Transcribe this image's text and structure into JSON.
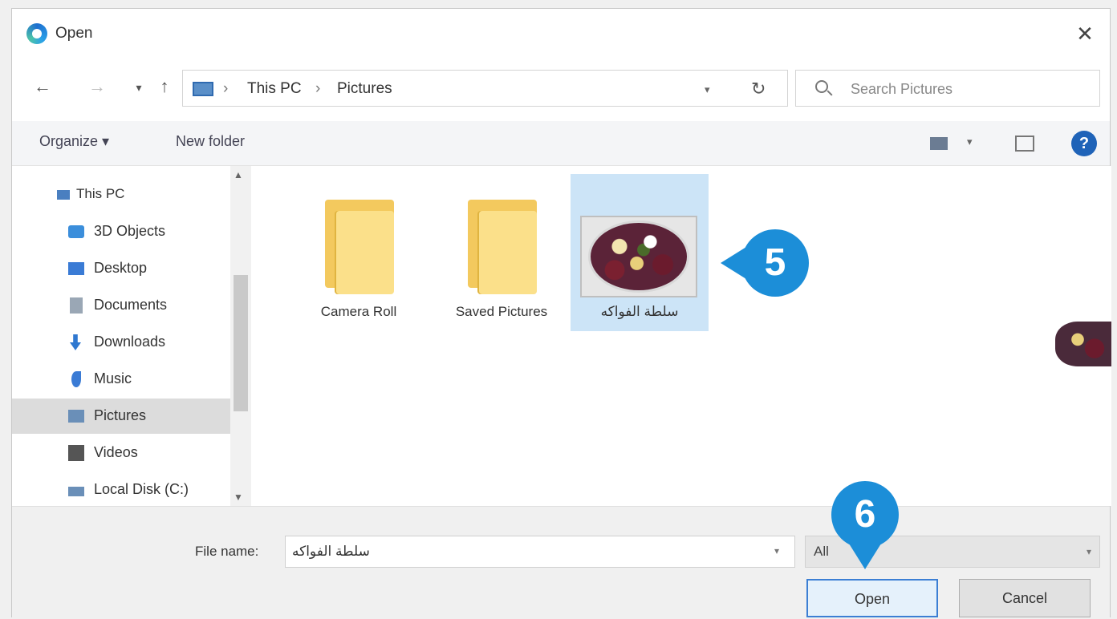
{
  "window": {
    "title": "Open",
    "close_symbol": "✕"
  },
  "nav": {
    "back": "←",
    "forward": "→",
    "recent": "▾",
    "up": "↑"
  },
  "address": {
    "sep": "›",
    "crumbs": [
      "This PC",
      "Pictures"
    ],
    "dropdown": "▾",
    "refresh": "↻"
  },
  "search": {
    "placeholder": "Search Pictures"
  },
  "toolbar": {
    "organize": "Organize ▾",
    "new_folder": "New folder",
    "view_dropdown": "▾",
    "help": "?"
  },
  "sidebar": {
    "scroll_up": "▲",
    "scroll_down": "▼",
    "items": [
      {
        "label": "This PC",
        "icon": "pc-icon",
        "color": "#4a7fc0"
      },
      {
        "label": "3D Objects",
        "icon": "cube-icon",
        "color": "#3b8edb"
      },
      {
        "label": "Desktop",
        "icon": "desktop-icon",
        "color": "#3a7bd5"
      },
      {
        "label": "Documents",
        "icon": "documents-icon",
        "color": "#9aa7b5"
      },
      {
        "label": "Downloads",
        "icon": "download-icon",
        "color": "#2f78d0"
      },
      {
        "label": "Music",
        "icon": "music-icon",
        "color": "#3a7bd5"
      },
      {
        "label": "Pictures",
        "icon": "pictures-icon",
        "color": "#6a8fb8"
      },
      {
        "label": "Videos",
        "icon": "videos-icon",
        "color": "#555"
      },
      {
        "label": "Local Disk (C:)",
        "icon": "disk-icon",
        "color": "#6a8fb8"
      }
    ],
    "selected_index": 6
  },
  "files": [
    {
      "name": "Camera Roll",
      "type": "folder"
    },
    {
      "name": "Saved Pictures",
      "type": "folder"
    },
    {
      "name": "سلطة الفواكه",
      "type": "image"
    }
  ],
  "callouts": {
    "five": "5",
    "six": "6"
  },
  "footer": {
    "file_name_label": "File name:",
    "file_name_value": "سلطة الفواكه",
    "file_type": "All",
    "open": "Open",
    "cancel": "Cancel"
  }
}
